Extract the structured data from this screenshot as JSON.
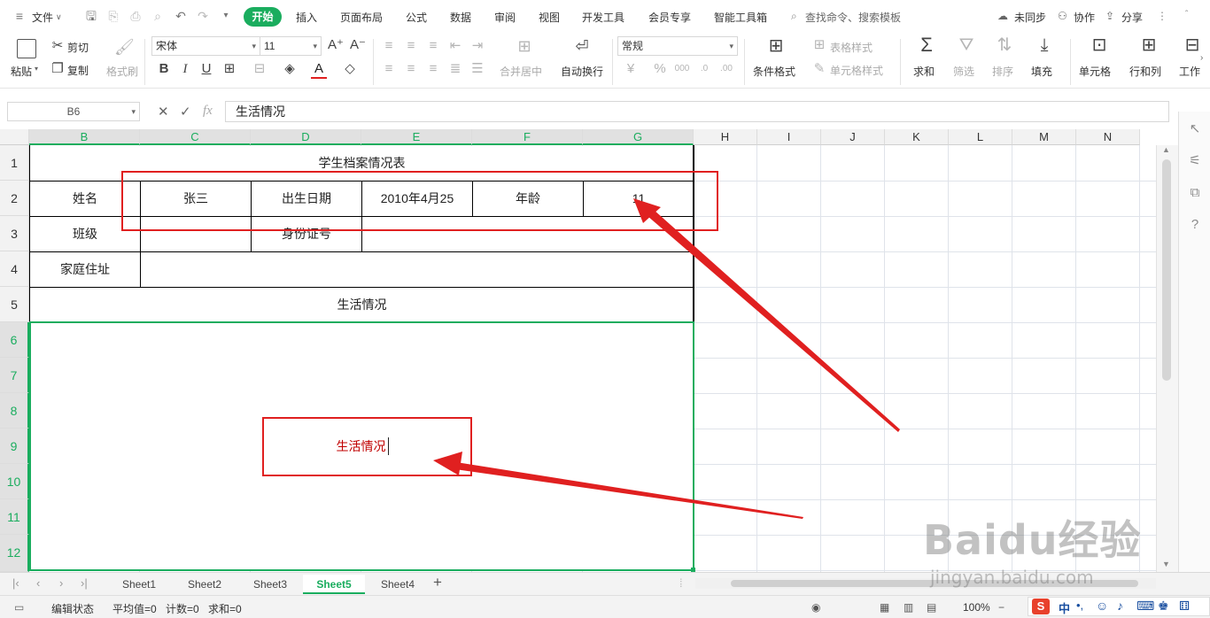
{
  "menubar": {
    "file_label": "文件",
    "tabs": [
      "开始",
      "插入",
      "页面布局",
      "公式",
      "数据",
      "审阅",
      "视图",
      "开发工具",
      "会员专享",
      "智能工具箱"
    ],
    "active_tab": "开始",
    "search_label": "查找命令、搜索模板",
    "sync_label": "未同步",
    "collab_label": "协作",
    "share_label": "分享"
  },
  "ribbon": {
    "paste": "粘贴",
    "cut": "剪切",
    "copy": "复制",
    "format_painter": "格式刷",
    "font_name": "宋体",
    "font_size": "11",
    "merge_center": "合并居中",
    "wrap_text": "自动换行",
    "number_format": "常规",
    "conditional_format": "条件格式",
    "table_style": "表格样式",
    "cell_style": "单元格样式",
    "sum": "求和",
    "filter": "筛选",
    "sort": "排序",
    "fill": "填充",
    "cell": "单元格",
    "row_col": "行和列",
    "worksheet": "工作"
  },
  "formula_bar": {
    "name_box": "B6",
    "fx_label": "fx",
    "content": "生活情况"
  },
  "columns": [
    "B",
    "C",
    "D",
    "E",
    "F",
    "G",
    "H",
    "I",
    "J",
    "K",
    "L",
    "M",
    "N"
  ],
  "selected_columns": [
    "B",
    "C",
    "D",
    "E",
    "F",
    "G"
  ],
  "rows": [
    "1",
    "2",
    "3",
    "4",
    "5",
    "6",
    "7",
    "8",
    "9",
    "10",
    "11",
    "12"
  ],
  "selected_rows": [
    "6",
    "7",
    "8",
    "9",
    "10",
    "11",
    "12"
  ],
  "sheet_cells": {
    "title": "学生档案情况表",
    "name_label": "姓名",
    "name_value": "张三",
    "birth_label": "出生日期",
    "birth_value": "2010年4月25",
    "age_label": "年龄",
    "age_value": "11",
    "class_label": "班级",
    "id_label": "身份证号",
    "address_label": "家庭住址",
    "life_header": "生活情况",
    "life_content": "生活情况"
  },
  "sheet_tabs": [
    "Sheet1",
    "Sheet2",
    "Sheet3",
    "Sheet5",
    "Sheet4"
  ],
  "active_sheet": "Sheet5",
  "status_bar": {
    "mode": "编辑状态",
    "average": "平均值=0",
    "count": "计数=0",
    "sum": "求和=0",
    "zoom": "100%"
  },
  "watermark": {
    "logo": "Baidu经验",
    "url": "jingyan.baidu.com"
  },
  "colors": {
    "accent_green": "#1aad5e",
    "annotation_red": "#e02020",
    "content_red": "#c00000"
  }
}
